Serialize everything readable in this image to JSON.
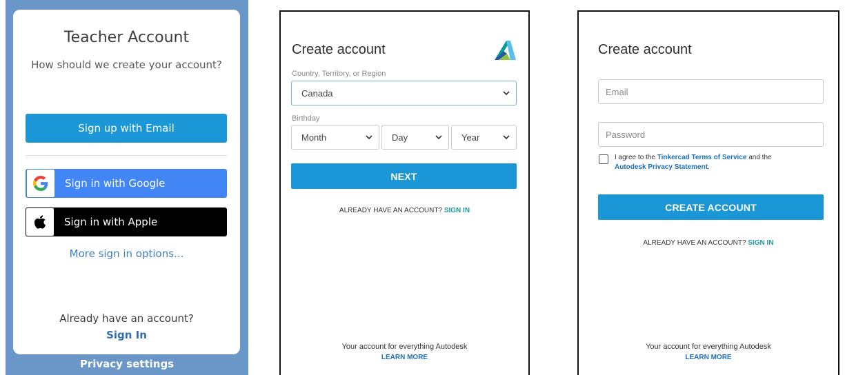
{
  "teacher": {
    "title": "Teacher Account",
    "subtitle": "How should we create your account?",
    "email_button": "Sign up with Email",
    "google_button": "Sign in with Google",
    "apple_button": "Sign in with Apple",
    "more_options": "More sign in options...",
    "already_text": "Already have an account?",
    "sign_in_link": "Sign In",
    "privacy_link": "Privacy settings",
    "icons": {
      "google": "google-icon",
      "apple": "apple-icon"
    }
  },
  "autodesk_step1": {
    "heading": "Create account",
    "logo": "autodesk-logo",
    "country_label": "Country, Territory, or Region",
    "country_value": "Canada",
    "birthday_label": "Birthday",
    "month_value": "Month",
    "day_value": "Day",
    "year_value": "Year",
    "next_button": "NEXT",
    "already_text": "ALREADY HAVE AN ACCOUNT?",
    "sign_in_link": "SIGN IN",
    "footer_text": "Your account for everything Autodesk",
    "learn_more": "LEARN MORE"
  },
  "autodesk_step2": {
    "heading": "Create account",
    "email_placeholder": "Email",
    "password_placeholder": "Password",
    "agree_prefix": "I agree to the",
    "terms_link": "Tinkercad Terms of Service",
    "agree_and": "and the",
    "privacy_link": "Autodesk Privacy Statement",
    "agree_suffix": ".",
    "create_button": "CREATE ACCOUNT",
    "already_text": "ALREADY HAVE AN ACCOUNT?",
    "sign_in_link": "SIGN IN",
    "footer_text": "Your account for everything Autodesk",
    "learn_more": "LEARN MORE"
  },
  "colors": {
    "teacher_bg": "#6a97c8",
    "primary_blue": "#1b96d6",
    "google_blue": "#4285f4",
    "teal_link": "#1f9a9d"
  }
}
